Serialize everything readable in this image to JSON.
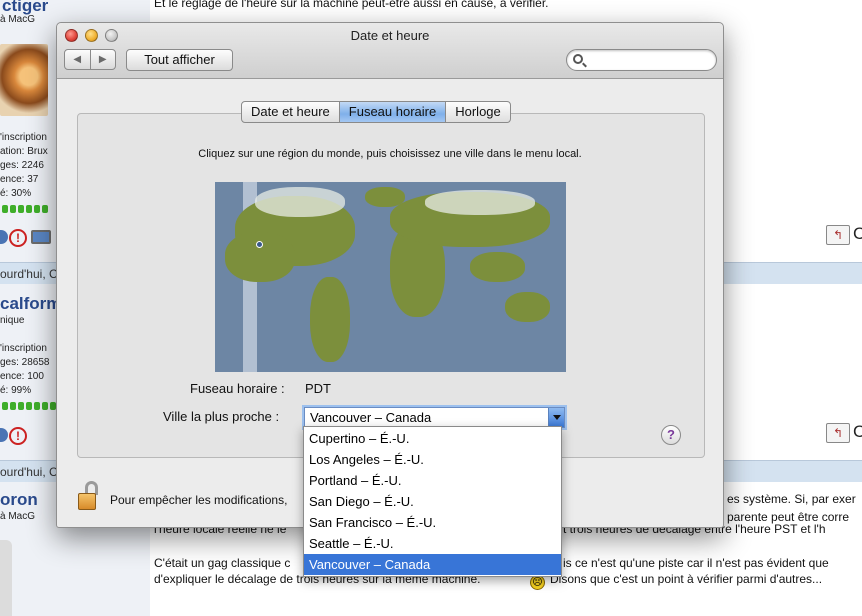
{
  "forum": {
    "top_text": "Et le réglage de l'heure sur la machine peut-être aussi en cause, à vérifier.",
    "user1": {
      "name": "ctiger",
      "role": "à MacG",
      "line1": "'inscription",
      "line2": "ation: Brux",
      "line3": "ges: 2246",
      "line4": "ence: 37",
      "line5": "é: 30%"
    },
    "sep1": "ourd'hui, C",
    "user2": {
      "name": "calform",
      "role": "nique",
      "line1": "'inscription",
      "line2": "ges: 28658",
      "line3": "ence: 100",
      "line4": "é: 99%"
    },
    "sep2": "ourd'hui, C",
    "user3": {
      "name": "oron",
      "role": "à MacG"
    },
    "quote_label": "C",
    "post_lines": [
      "es système. Si, par exer",
      "l'heure locale réelle ne le",
      "parente peut être corre",
      "t trois heures de décalage entre l'heure PST et l'h",
      "C'était un gag classique c",
      "is ce n'est qu'une piste car il n'est pas évident que",
      "d'expliquer le décalage de trois heures sur la même machine.",
      "Disons que c'est un point à vérifier parmi d'autres..."
    ]
  },
  "window": {
    "title": "Date et heure",
    "back_glyph": "◀",
    "forward_glyph": "▶",
    "show_all": "Tout afficher",
    "search_placeholder": "",
    "tabs": [
      {
        "label": "Date et heure",
        "active": false
      },
      {
        "label": "Fuseau horaire",
        "active": true
      },
      {
        "label": "Horloge",
        "active": false
      }
    ],
    "instruction": "Cliquez sur une région du monde, puis choisissez une ville dans le menu local.",
    "timezone_label": "Fuseau horaire :",
    "timezone_value": "PDT",
    "closest_city_label": "Ville la plus proche :",
    "closest_city_value": "Vancouver – Canada",
    "help": "?",
    "lock_text": "Pour empêcher les modifications,"
  },
  "city_options": [
    "Cupertino – É.-U.",
    "Los Angeles – É.-U.",
    "Portland – É.-U.",
    "San Diego – É.-U.",
    "San Francisco – É.-U.",
    "Seattle – É.-U.",
    "Vancouver – Canada"
  ],
  "selected_option": "Vancouver – Canada",
  "colors": {
    "selection": "#3875d7",
    "tab_active": "#7fb0ea",
    "map_ocean": "#6d86a4",
    "map_land": "#7c8f3c"
  },
  "icons": [
    "back-icon",
    "forward-icon",
    "search-icon",
    "lock-icon",
    "help-icon",
    "warning-icon",
    "monitor-icon",
    "quote-icon",
    "smiley-icon"
  ]
}
